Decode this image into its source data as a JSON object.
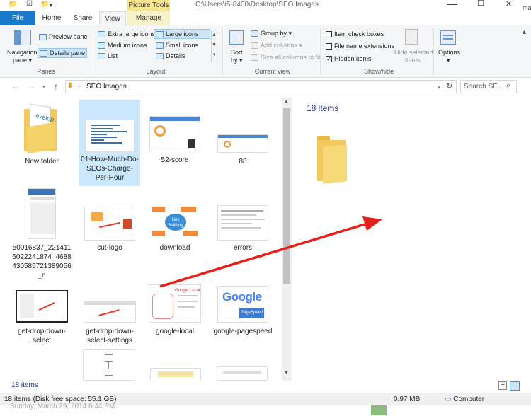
{
  "titlebar": {
    "picture_tools": "Picture Tools",
    "title": "C:\\Users\\i5-8400\\Desktop\\SEO Images",
    "min": "—",
    "max": "☐",
    "close": "✕",
    "edge_text": "ma"
  },
  "tabs": {
    "file": "File",
    "home": "Home",
    "share": "Share",
    "view": "View",
    "manage": "Manage"
  },
  "ribbon": {
    "panes": {
      "nav_pane": "Navigation",
      "nav_pane2": "pane ▾",
      "preview_pane": "Preview pane",
      "details_pane": "Details pane",
      "label": "Panes"
    },
    "layout": {
      "extra_large": "Extra large icons",
      "large": "Large icons",
      "medium": "Medium icons",
      "small": "Small icons",
      "list": "List",
      "details": "Details",
      "label": "Layout"
    },
    "current_view": {
      "sort": "Sort",
      "sort2": "by ▾",
      "group_by": "Group by ▾",
      "add_columns": "Add columns ▾",
      "size_all": "Size all columns to fit",
      "label": "Current view"
    },
    "show_hide": {
      "item_check_boxes": "Item check boxes",
      "file_name_ext": "File name extensions",
      "hidden_items": "Hidden items",
      "hide_selected": "Hide selected",
      "hide_selected2": "items",
      "label": "Show/hide"
    },
    "options": {
      "label": "Options",
      "arrow": "▾"
    }
  },
  "address": {
    "path": "SEO Images",
    "search_placeholder": "Search SE..."
  },
  "items": [
    {
      "label": "New folder"
    },
    {
      "label": "01-How-Much-Do-SEOs-Charge-Per-Hour"
    },
    {
      "label": "52-score"
    },
    {
      "label": "88"
    },
    {
      "label": "50016837_2214116022241874_4688430585721389056_n"
    },
    {
      "label": "cut-logo"
    },
    {
      "label": "download"
    },
    {
      "label": "errors"
    },
    {
      "label": "get-drop-down-select"
    },
    {
      "label": "get-drop-down-select-settings"
    },
    {
      "label": "google-local"
    },
    {
      "label": "google-pagespeed"
    }
  ],
  "thumb_text": {
    "link_building": "Link Building",
    "google": "Google",
    "pagespeed": "PageSpeed",
    "google_local": "Google Local"
  },
  "preview": {
    "count": "18 items"
  },
  "status": {
    "count": "18 items",
    "disk": "18 items (Disk free space: 55.1 GB)",
    "size": "0.97 MB",
    "computer": "Computer"
  },
  "taskbar": {
    "date_text": "Sunday, March 29, 2014 6:44 PM"
  },
  "colors": {
    "accent": "#1979ca",
    "arrow": "#e8201c",
    "folder": "#f3c95b"
  }
}
